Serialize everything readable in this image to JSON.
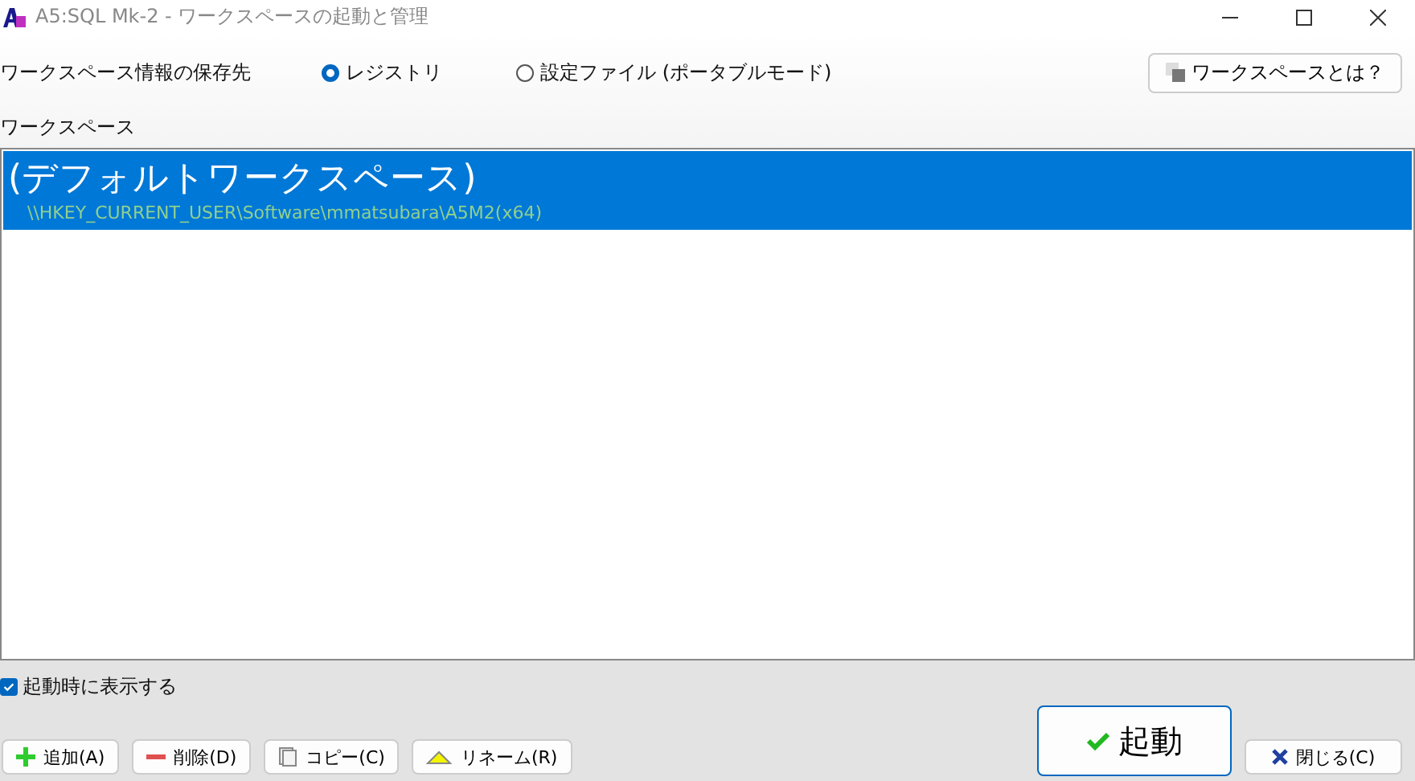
{
  "window": {
    "title": "A5:SQL Mk-2 - ワークスペースの起動と管理"
  },
  "storage": {
    "label": "ワークスペース情報の保存先",
    "options": [
      {
        "label": "レジストリ",
        "selected": true
      },
      {
        "label": "設定ファイル (ポータブルモード)",
        "selected": false
      }
    ]
  },
  "help_button": "ワークスペースとは？",
  "workspaces": {
    "label": "ワークスペース",
    "items": [
      {
        "name": "(デフォルトワークスペース)",
        "path": "\\\\HKEY_CURRENT_USER\\Software\\mmatsubara\\A5M2(x64)",
        "selected": true
      }
    ]
  },
  "show_on_startup": {
    "label": "起動時に表示する",
    "checked": true
  },
  "buttons": [
    {
      "kind": "add",
      "label": "追加(A)"
    },
    {
      "kind": "delete",
      "label": "削除(D)"
    },
    {
      "kind": "copy",
      "label": "コピー(C)"
    },
    {
      "kind": "rename",
      "label": "リネーム(R)"
    }
  ],
  "start_button": "起動",
  "close_button": "閉じる(C)"
}
